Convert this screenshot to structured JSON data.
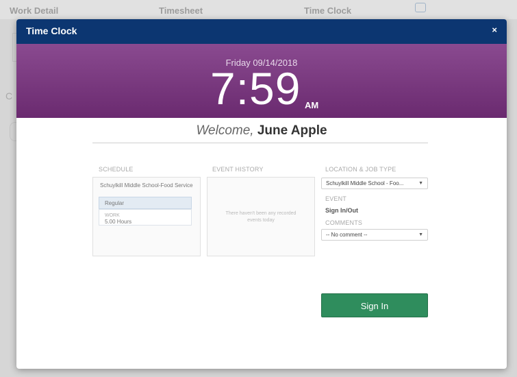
{
  "background_app": {
    "tabs": [
      "Work Detail",
      "Timesheet",
      "Time Clock"
    ],
    "side_letter": "C"
  },
  "modal": {
    "title": "Time Clock",
    "close_label": "×"
  },
  "clock": {
    "date": "Friday 09/14/2018",
    "time": "7:59",
    "ampm": "AM"
  },
  "welcome": {
    "lead": "Welcome,",
    "name": "June Apple"
  },
  "schedule": {
    "label": "SCHEDULE",
    "location": "Schuylkill Middle School-Food Service",
    "type": "Regular",
    "work_label": "WORK",
    "work_value": "5.00 Hours"
  },
  "event_history": {
    "label": "EVENT HISTORY",
    "empty_text": "There haven't been any recorded events today"
  },
  "location_job": {
    "label": "LOCATION & JOB TYPE",
    "selected": "Schuylkill Middle School - Foo..."
  },
  "event": {
    "label": "EVENT",
    "value": "Sign In/Out"
  },
  "comments": {
    "label": "COMMENTS",
    "selected": "-- No comment --"
  },
  "actions": {
    "sign_in": "Sign In"
  },
  "colors": {
    "header": "#0c3671",
    "clock_band": "#7a3a80",
    "sign_in_button": "#2f8d5d"
  }
}
